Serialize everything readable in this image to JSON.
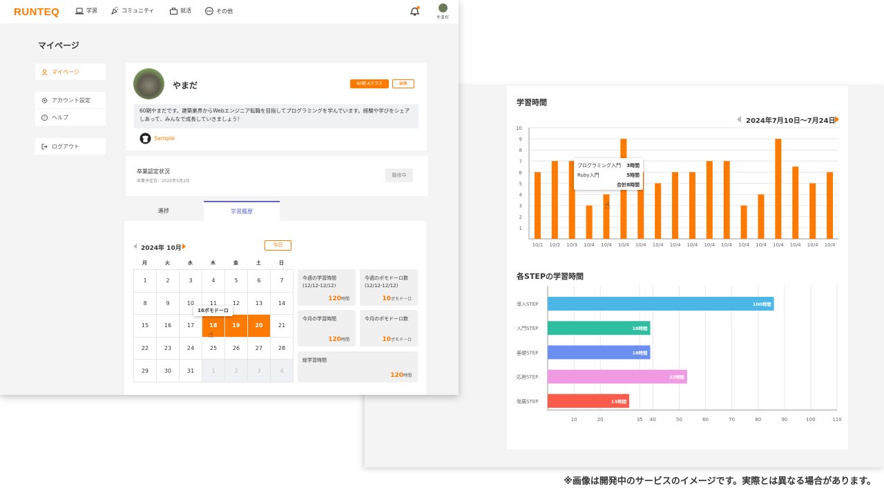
{
  "disclaimer": "※画像は開発中のサービスのイメージです。実際とは異なる場合があります。",
  "colors": {
    "accent": "#ff7a00",
    "panel_bg": "#f4f4f4"
  },
  "header": {
    "logo": "RUNTEQ",
    "nav": [
      {
        "label": "学習",
        "icon": "laptop-icon"
      },
      {
        "label": "コミュニティ",
        "icon": "party-icon"
      },
      {
        "label": "就活",
        "icon": "briefcase-icon"
      },
      {
        "label": "その他",
        "icon": "more-icon"
      }
    ],
    "user": "やまだ",
    "bell_icon": "bell-icon"
  },
  "page_title": "マイページ",
  "sidebar": {
    "items": [
      {
        "label": "マイページ",
        "icon": "user-icon",
        "active": true
      },
      {
        "label": "アカウント設定",
        "icon": "gear-icon"
      },
      {
        "label": "ヘルプ",
        "icon": "help-icon"
      },
      {
        "label": "ログアウト",
        "icon": "logout-icon"
      }
    ]
  },
  "profile": {
    "name": "やまだ",
    "class_badge": "60期 Aクラス",
    "edit": "編集",
    "bio": "60期やまだです。建築業界からWebエンジニア転職を目指してプログラミングを学んでいます。経験や学びをシェアしあって、みんなで成長していきましょう！",
    "github": "Sample"
  },
  "graduation": {
    "title": "卒業認定状況",
    "date": "卒業予定日：2025年5月2日",
    "status": "履修中"
  },
  "tabs": [
    {
      "label": "進捗"
    },
    {
      "label": "学習履歴",
      "active": true
    }
  ],
  "calendar": {
    "month": "2024年 10月",
    "today": "今日",
    "dows": [
      "月",
      "火",
      "水",
      "木",
      "金",
      "土",
      "日"
    ],
    "weeks": [
      [
        "1",
        "2",
        "3",
        "4",
        "5",
        "6",
        "7"
      ],
      [
        "8",
        "9",
        "10",
        "11",
        "12",
        "13",
        "14"
      ],
      [
        "15",
        "16",
        "17",
        "18",
        "19",
        "20",
        "21"
      ],
      [
        "22",
        "23",
        "24",
        "25",
        "26",
        "27",
        "28"
      ],
      [
        "29",
        "30",
        "31",
        "1",
        "2",
        "3",
        "4"
      ]
    ],
    "highlight": [
      "18",
      "19",
      "20"
    ],
    "tooltip": "16ポモドーロ"
  },
  "stats": [
    {
      "label": "今週の学習時間",
      "sub": "(12/12-12/12)",
      "value": "120",
      "unit": "時間"
    },
    {
      "label": "今週のポモドーロ数",
      "sub": "(12/12-12/12)",
      "value": "10",
      "unit": "ポモドーロ"
    },
    {
      "label": "今月の学習時間",
      "sub": "",
      "value": "120",
      "unit": "時間"
    },
    {
      "label": "今月のポモドーロ数",
      "sub": "",
      "value": "10",
      "unit": "ポモドーロ"
    },
    {
      "label": "総学習時間",
      "sub": "",
      "value": "120",
      "unit": "時間"
    }
  ],
  "study_time": {
    "title": "学習時間",
    "range": "2024年7月10日〜7月24日",
    "tooltip": {
      "rows": [
        {
          "name": "プログラミング入門",
          "val": "3時間"
        },
        {
          "name": "Ruby入門",
          "val": "5時間"
        }
      ],
      "total": "合計8時間"
    }
  },
  "step_time": {
    "title": "各STEPの学習時間"
  },
  "chart_data": [
    {
      "type": "bar",
      "title": "学習時間",
      "categories": [
        "10/1",
        "10/2",
        "10/3",
        "10/4",
        "10/4",
        "10/4",
        "10/4",
        "10/4",
        "10/4",
        "10/4",
        "10/4",
        "10/4",
        "10/4",
        "10/4",
        "10/4",
        "10/4",
        "10/4",
        "10/4"
      ],
      "values": [
        6,
        7,
        7,
        3,
        4,
        9,
        6,
        5,
        6,
        6,
        7,
        7,
        3,
        4,
        9,
        6.5,
        5,
        6
      ],
      "yticks": [
        "1",
        "2",
        "3",
        "4",
        "5",
        "6",
        "7",
        "8",
        "9",
        "10"
      ],
      "ylim": [
        0,
        10
      ],
      "color": "#ff7a00"
    },
    {
      "type": "bar",
      "orientation": "horizontal",
      "title": "各STEPの学習時間",
      "categories": [
        "導入STEP",
        "入門STEP",
        "基礎STEP",
        "応用STEP",
        "発展STEP"
      ],
      "values": [
        100,
        18,
        18,
        22,
        13
      ],
      "display_values": [
        86,
        39,
        39,
        53,
        31
      ],
      "value_labels": [
        "100時間",
        "18時間",
        "18時間",
        "22時間",
        "13時間"
      ],
      "colors": [
        "#4ab7e6",
        "#2ebfa0",
        "#6b8ff0",
        "#f19ae4",
        "#fb5b4b"
      ],
      "xticks": [
        "10",
        "20",
        "35",
        "40",
        "50",
        "60",
        "70",
        "80",
        "90",
        "100",
        "110"
      ],
      "xlim": [
        0,
        110
      ]
    }
  ]
}
